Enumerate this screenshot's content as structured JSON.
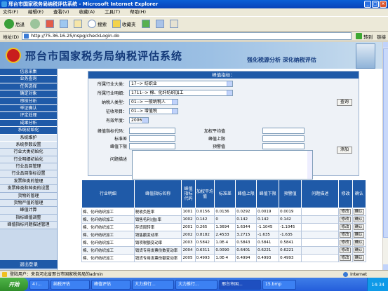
{
  "window": {
    "title": "邢台市国家税务局纳税评估系统 - Microsoft Internet Explorer"
  },
  "menu": [
    "文件(F)",
    "编辑(E)",
    "查看(V)",
    "收藏(A)",
    "工具(T)",
    "帮助(H)"
  ],
  "toolbar": {
    "back": "后退",
    "search": "搜索",
    "favorites": "收藏夹"
  },
  "address": {
    "label": "地址(D)",
    "url": "http://75.36.16.25/nspg/checkLogin.do",
    "go": "转到",
    "links": "链接"
  },
  "banner": {
    "title": "邢台市国家税务局纳税评估系统",
    "slogan": "强化税源分析  深化纳税评估"
  },
  "sidebar": {
    "sections": [
      {
        "label": "信息采集"
      },
      {
        "label": "业务查询"
      },
      {
        "label": "任务选择"
      },
      {
        "label": "确定对象"
      },
      {
        "label": "审核分析"
      },
      {
        "label": "举证确认"
      },
      {
        "label": "评定处理"
      },
      {
        "label": "成果分析"
      },
      {
        "label": "系统初始化"
      },
      {
        "label": "系统维护"
      }
    ],
    "subitems": [
      "系统参数设置",
      "行业大类初始化",
      "行业明细初始化",
      "行业品目管理",
      "行业品目指标设置",
      "发票种类的管理",
      "发票种类和种类的设置",
      "货物的管理",
      "货物严值的管理",
      "峰值计算",
      "指标峰值调整",
      "峰值指标问题描述管理"
    ],
    "logout": "退出登录"
  },
  "form": {
    "header": "峰值指标：",
    "industry_major_label": "所属行业大类：",
    "industry_major_value": "17--> 纺织业",
    "industry_detail_label": "所属行业明细：",
    "industry_detail_value": "1711--> 棉、化纤纺织加工",
    "taxpayer_type_label": "纳税人类型：",
    "taxpayer_type_value": "01--> 一般纳税人",
    "tax_item_label": "征收项目：",
    "tax_item_value": "01--> 增值税",
    "year_label": "有效年度：",
    "year_value": "2006",
    "query_button": "查询",
    "indicator_code_label": "峰值指标代码：",
    "weighted_avg_label": "加权平均值",
    "std_dev_label": "标准差",
    "upper_label": "峰值上限",
    "lower_label": "峰值下限",
    "warning_label": "预警值",
    "add_button": "添加",
    "problem_label": "问题描述"
  },
  "table": {
    "headers": [
      "行业明细",
      "峰值指标名称",
      "峰值指标代码",
      "加权平均值",
      "标准差",
      "峰值上限",
      "峰值下限",
      "预警值",
      "问题描述",
      "修改",
      "确认"
    ],
    "rows": [
      [
        "棉、化纤纺织加工",
        "税收负担率",
        "1001",
        "0.0156",
        "0.0136",
        "0.0292",
        "0.0019",
        "0.0019",
        "",
        "修改",
        "确认"
      ],
      [
        "棉、化纤纺织加工",
        "销售毛利(益)率",
        "1002",
        "0.142",
        "0",
        "0.142",
        "0.142",
        "0.142",
        "",
        "修改",
        "确认"
      ],
      [
        "棉、化纤纺织加工",
        "存货周转率",
        "2001",
        "0.265",
        "1.3694",
        "1.6344",
        "-1.1045",
        "-1.1045",
        "",
        "修改",
        "确认"
      ],
      [
        "棉、化纤纺织加工",
        "销售额变动率",
        "2002",
        "0.8182",
        "2.4533",
        "3.2715",
        "-1.635",
        "-1.635",
        "",
        "修改",
        "确认"
      ],
      [
        "棉、化纤纺织加工",
        "销项税额变动率",
        "2003",
        "0.5842",
        "1.0E-4",
        "0.5843",
        "0.5841",
        "0.5841",
        "",
        "修改",
        "确认"
      ],
      [
        "棉、化纤纺织加工",
        "销货专用发票份数变动率",
        "2004",
        "0.6311",
        "0.0090",
        "0.6401",
        "0.6221",
        "0.6221",
        "",
        "修改",
        "确认"
      ],
      [
        "棉、化纤纺织加工",
        "销货专用发票份额变动率",
        "2005",
        "0.4993",
        "1.0E-4",
        "0.4994",
        "0.4993",
        "0.4993",
        "",
        "修改",
        "确认"
      ]
    ]
  },
  "status": {
    "text": "登陆用户：来自河北省邢台市国家税务局的admin",
    "zone": "Internet"
  },
  "taskbar": {
    "start": "开始",
    "tasks": [
      "4 I...",
      "纳税评估",
      "峰值评估",
      "大力推行...",
      "大力推行...",
      "邢台市国...",
      "15.bmp"
    ],
    "time": "14:34"
  }
}
